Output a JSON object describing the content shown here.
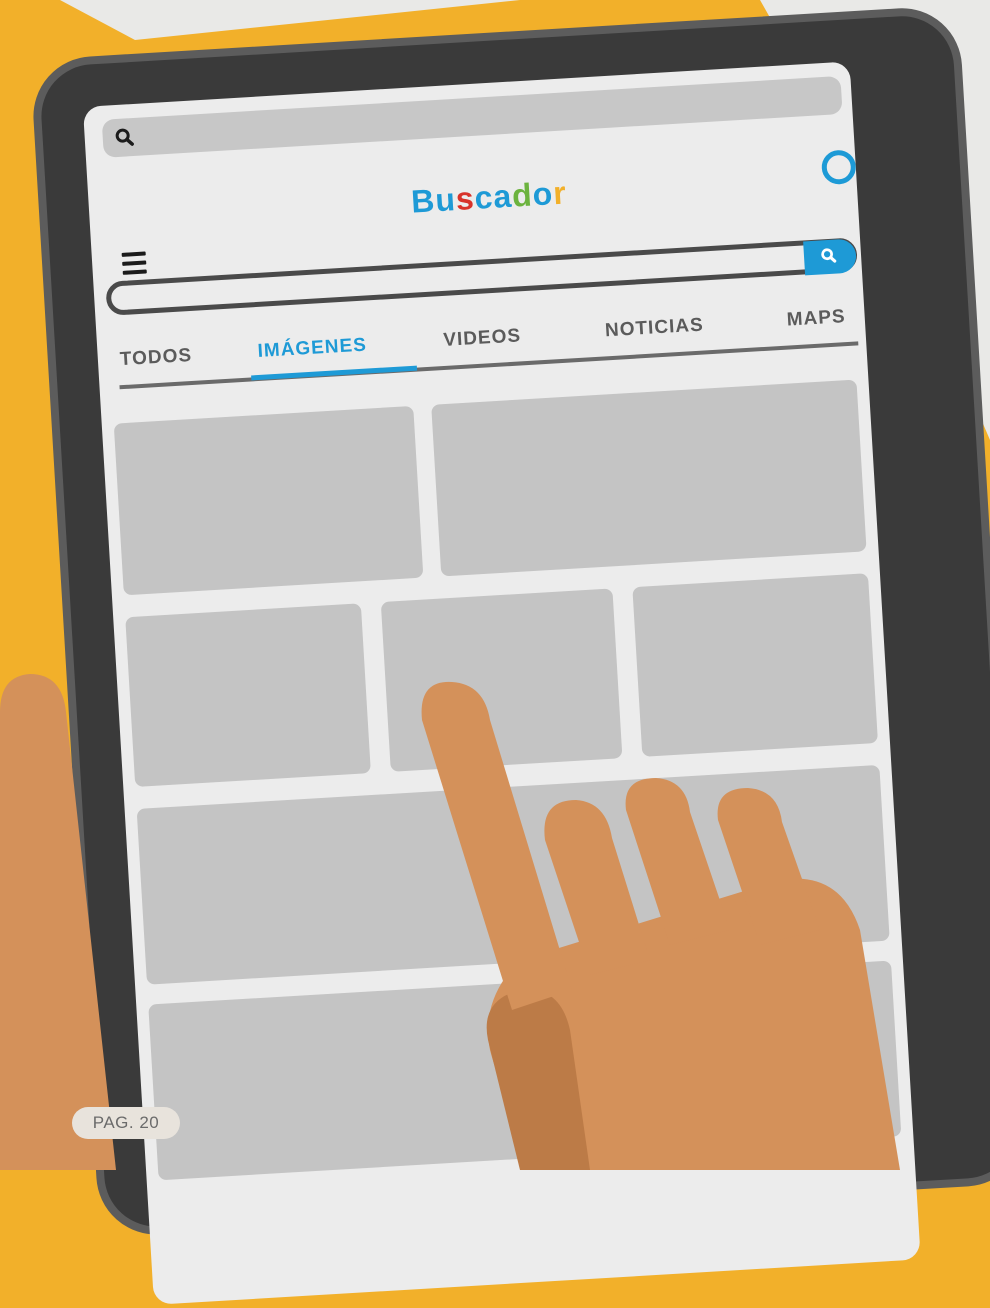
{
  "colors": {
    "background": "#f2b02a",
    "accent": "#1e9ad6",
    "tile": "#c4c4c4",
    "skin": "#d4915a"
  },
  "address_bar": {
    "icon": "search-icon"
  },
  "header": {
    "logo_letters": [
      {
        "char": "B",
        "color": "#1e9ad6"
      },
      {
        "char": "u",
        "color": "#1e9ad6"
      },
      {
        "char": "s",
        "color": "#d8322a"
      },
      {
        "char": "c",
        "color": "#1e9ad6"
      },
      {
        "char": "a",
        "color": "#1e9ad6"
      },
      {
        "char": "d",
        "color": "#6cb33e"
      },
      {
        "char": "o",
        "color": "#1e9ad6"
      },
      {
        "char": "r",
        "color": "#f2b02a"
      }
    ],
    "menu_icon": "hamburger-icon",
    "assistant_icon": "circle-icon"
  },
  "search": {
    "button_icon": "search-icon"
  },
  "tabs": [
    {
      "label": "TODOS",
      "active": false
    },
    {
      "label": "IMÁGENES",
      "active": true
    },
    {
      "label": "VIDEOS",
      "active": false
    },
    {
      "label": "NOTICIAS",
      "active": false
    },
    {
      "label": "MAPS",
      "active": false
    }
  ],
  "page_label": "PAG. 20"
}
